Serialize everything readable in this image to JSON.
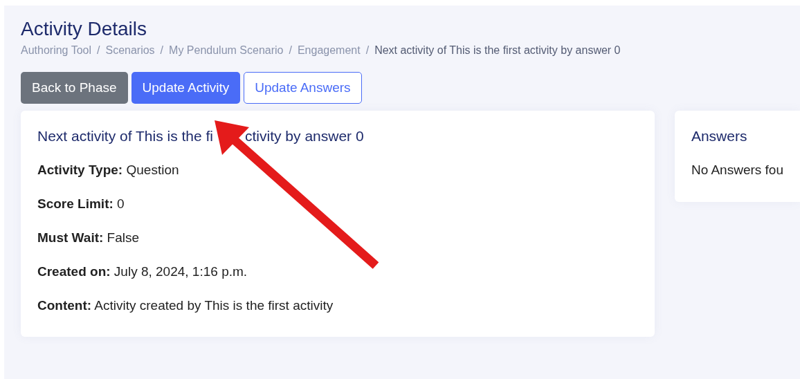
{
  "page": {
    "title": "Activity Details"
  },
  "breadcrumb": [
    {
      "label": "Authoring Tool",
      "current": false
    },
    {
      "label": "Scenarios",
      "current": false
    },
    {
      "label": "My Pendulum Scenario",
      "current": false
    },
    {
      "label": "Engagement",
      "current": false
    },
    {
      "label": "Next activity of This is the first activity by answer 0",
      "current": true
    }
  ],
  "breadcrumb_separator": "/",
  "buttons": [
    {
      "label": "Back to Phase",
      "kind": "secondary"
    },
    {
      "label": "Update Activity",
      "kind": "primary"
    },
    {
      "label": "Update Answers",
      "kind": "outline"
    }
  ],
  "activity_card": {
    "title_parts": [
      "Next activity of This is the fi",
      "ctivity by answer 0"
    ],
    "fields": [
      {
        "label": "Activity Type:",
        "value": "Question"
      },
      {
        "label": "Score Limit:",
        "value": "0"
      },
      {
        "label": "Must Wait:",
        "value": "False"
      },
      {
        "label": "Created on:",
        "value": "July 8, 2024, 1:16 p.m."
      },
      {
        "label": "Content:",
        "value": "Activity created by This is the first activity"
      }
    ]
  },
  "answers_card": {
    "title": "Answers",
    "message": "No Answers fou"
  }
}
